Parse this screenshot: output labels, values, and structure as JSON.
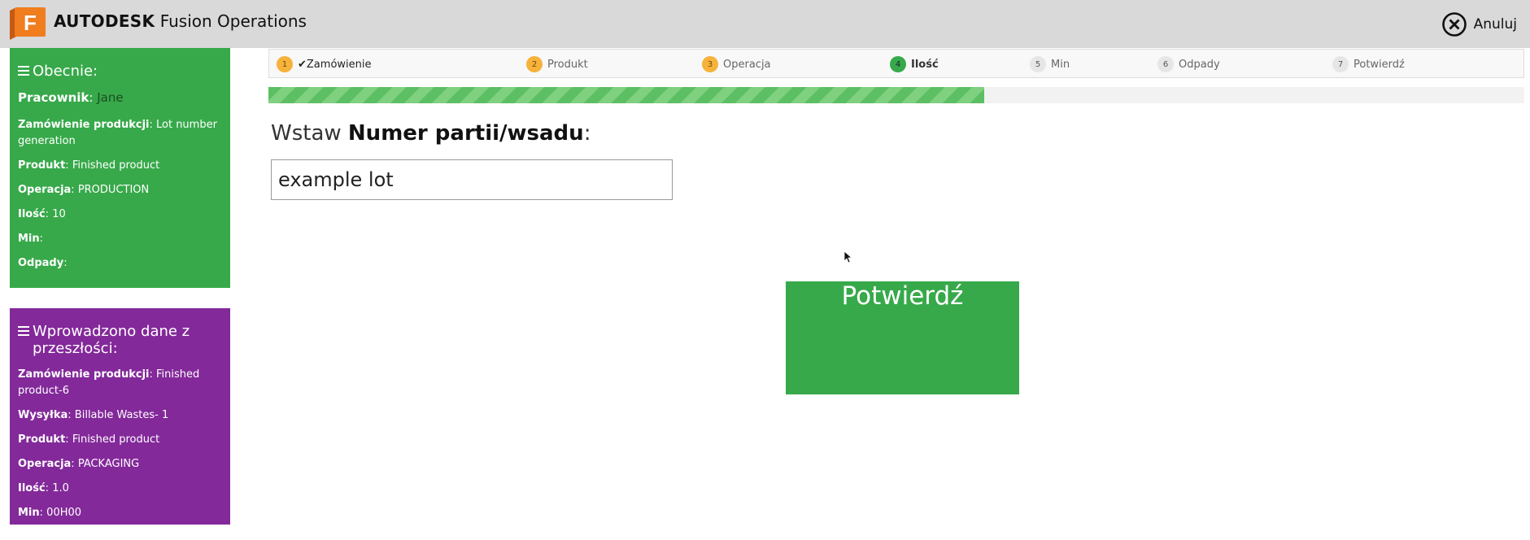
{
  "header": {
    "brand": "AUTODESK",
    "product": "Fusion Operations",
    "logo_letter": "F",
    "cancel_label": "Anuluj",
    "cancel_icon": "close-circle-icon"
  },
  "current": {
    "title": "Obecnie:",
    "worker_label": "Pracownik",
    "worker_value": "Jane",
    "order_label": "Zamówienie produkcji",
    "order_value": "Lot number generation",
    "product_label": "Produkt",
    "product_value": "Finished product",
    "operation_label": "Operacja",
    "operation_value": "PRODUCTION",
    "qty_label": "Ilość",
    "qty_value": "10",
    "min_label": "Min",
    "min_value": "",
    "waste_label": "Odpady",
    "waste_value": ""
  },
  "past": {
    "title": "Wprowadzono dane z przeszłości:",
    "order_label": "Zamówienie produkcji",
    "order_value": "Finished product-6",
    "shipping_label": "Wysyłka",
    "shipping_value": "Billable Wastes- 1",
    "product_label": "Produkt",
    "product_value": "Finished product",
    "operation_label": "Operacja",
    "operation_value": "PACKAGING",
    "qty_label": "Ilość",
    "qty_value": "1.0",
    "min_label": "Min",
    "min_value": "00H00"
  },
  "steps": [
    {
      "num": "1",
      "label": "Zamówienie",
      "check": "✔"
    },
    {
      "num": "2",
      "label": "Produkt"
    },
    {
      "num": "3",
      "label": "Operacja"
    },
    {
      "num": "4",
      "label": "Ilość"
    },
    {
      "num": "5",
      "label": "Min"
    },
    {
      "num": "6",
      "label": "Odpady"
    },
    {
      "num": "7",
      "label": "Potwierdź"
    }
  ],
  "progress": {
    "fraction": 0.57
  },
  "form": {
    "prompt_prefix": "Wstaw",
    "prompt_bold": "Numer partii/wsadu",
    "prompt_suffix": ":",
    "lot_value": "example lot"
  },
  "confirm_label": "Potwierdź",
  "colors": {
    "accent_green": "#37a94a",
    "past_purple": "#83299a",
    "step_done": "#f6b23b",
    "header_bg": "#d9d9d9"
  }
}
